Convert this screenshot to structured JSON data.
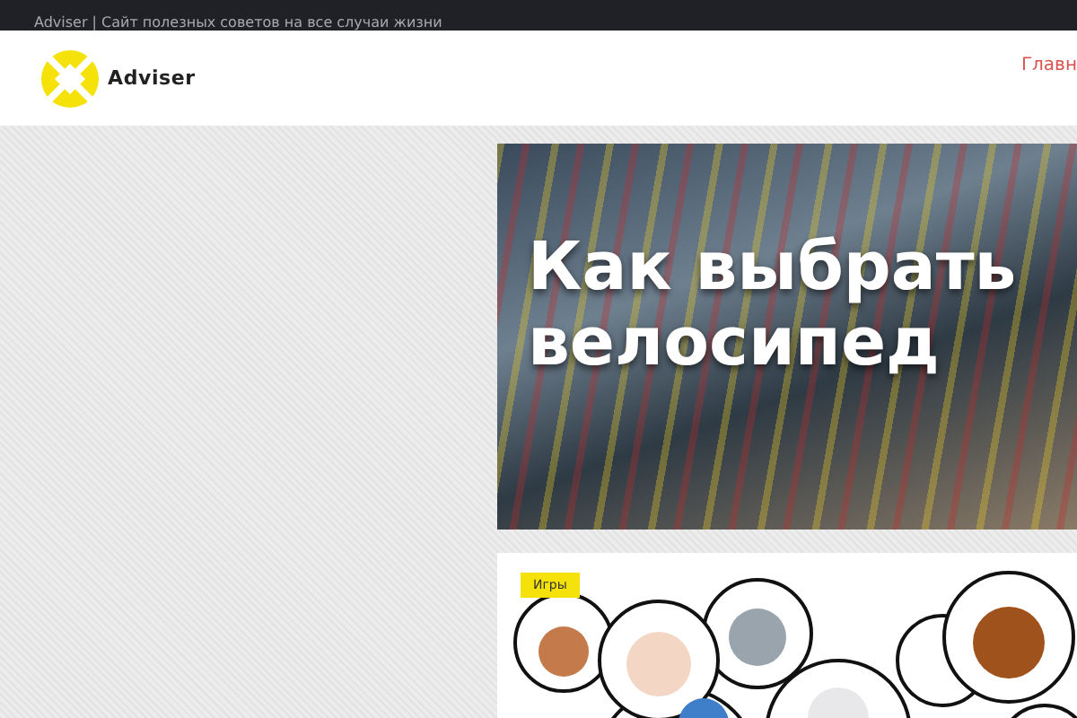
{
  "top_bar": {
    "tagline": "Adviser | Сайт полезных советов на все случаи жизни"
  },
  "header": {
    "logo_text": "Adviser",
    "nav": [
      {
        "label": "Главн"
      }
    ]
  },
  "posts": [
    {
      "kind": "photo",
      "title": "Как выбрать велосипед"
    },
    {
      "kind": "illustration",
      "tag": "Игры"
    }
  ]
}
